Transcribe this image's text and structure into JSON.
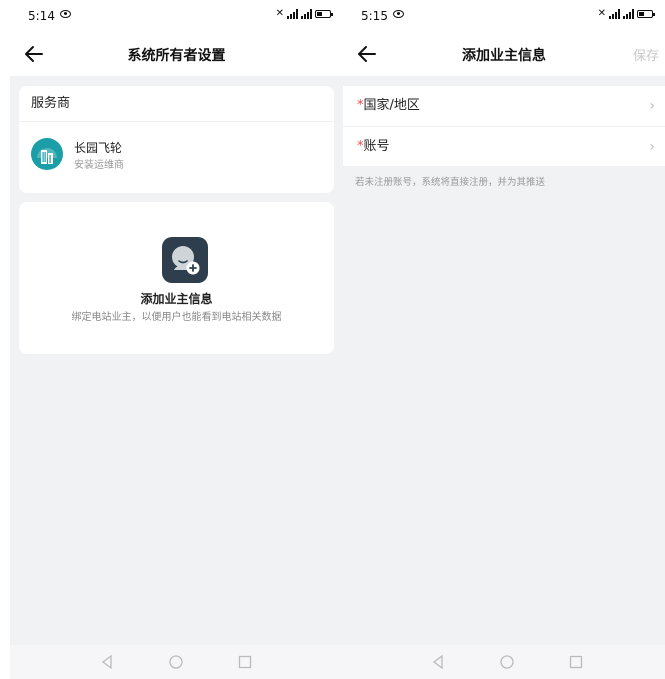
{
  "left": {
    "status": {
      "time": "5:14"
    },
    "nav": {
      "title": "系统所有者设置"
    },
    "provider": {
      "header": "服务商",
      "name": "长园飞轮",
      "role": "安装运维商"
    },
    "add_owner": {
      "title": "添加业主信息",
      "description": "绑定电站业主，以便用户也能看到电站相关数据"
    }
  },
  "right": {
    "status": {
      "time": "5:15"
    },
    "nav": {
      "title": "添加业主信息",
      "save_label": "保存"
    },
    "form": {
      "required_mark": "*",
      "fields": [
        {
          "label": "国家/地区"
        },
        {
          "label": "账号"
        }
      ],
      "chevron": "›",
      "hint": "若未注册账号，系统将直接注册，并为其推送"
    }
  },
  "colors": {
    "required": "#e84a4a",
    "logo": "#1a9fa8",
    "add_icon_bg": "#2e3e4c",
    "background": "#f1f2f4"
  },
  "icons": [
    "eye-icon",
    "mute-icon",
    "signal-icon",
    "battery-icon",
    "back-arrow-icon",
    "building-logo-icon",
    "add-owner-icon",
    "chevron-right-icon",
    "nav-back-icon",
    "nav-home-icon",
    "nav-recent-icon"
  ]
}
